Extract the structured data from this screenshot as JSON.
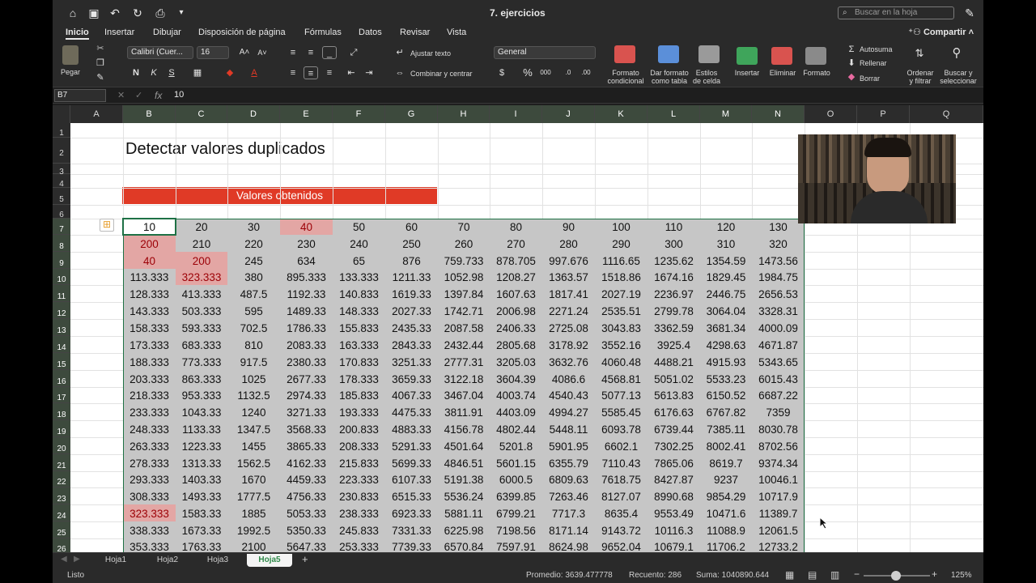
{
  "titlebar": {
    "title": "7. ejercicios",
    "search_placeholder": "Buscar en la hoja"
  },
  "tabs": {
    "items": [
      "Inicio",
      "Insertar",
      "Dibujar",
      "Disposición de página",
      "Fórmulas",
      "Datos",
      "Revisar",
      "Vista"
    ],
    "active": "Inicio",
    "share": "Compartir"
  },
  "ribbon": {
    "paste": "Pegar",
    "font_name": "Calibri (Cuer...",
    "font_size": "16",
    "wrap_text": "Ajustar texto",
    "merge_center": "Combinar y centrar",
    "number_format": "General",
    "cond_format": [
      "Formato",
      "condicional"
    ],
    "format_table": [
      "Dar formato",
      "como tabla"
    ],
    "cell_styles": [
      "Estilos",
      "de celda"
    ],
    "insert": "Insertar",
    "delete": "Eliminar",
    "format": "Formato",
    "autosum": "Autosuma",
    "fill": "Rellenar",
    "clear": "Borrar",
    "sort_filter": [
      "Ordenar",
      "y filtrar"
    ],
    "find_select": [
      "Buscar y",
      "seleccionar"
    ]
  },
  "formula_bar": {
    "name_box": "B7",
    "fx": "fx",
    "value": "10"
  },
  "columns": [
    "A",
    "B",
    "C",
    "D",
    "E",
    "F",
    "G",
    "H",
    "I",
    "J",
    "K",
    "L",
    "M",
    "N",
    "O",
    "P",
    "Q"
  ],
  "rows": [
    "1",
    "2",
    "3",
    "4",
    "5",
    "6",
    "7",
    "8",
    "9",
    "10",
    "11",
    "12",
    "13",
    "14",
    "15",
    "16",
    "17",
    "18",
    "19",
    "20",
    "21",
    "22",
    "23",
    "24",
    "25",
    "26"
  ],
  "sheet": {
    "title": "Detectar valores duplicados",
    "banner": "Valores obtenidos",
    "data_rows": [
      [
        "10",
        "20",
        "30",
        "40",
        "50",
        "60",
        "70",
        "80",
        "90",
        "100",
        "110",
        "120",
        "130"
      ],
      [
        "200",
        "210",
        "220",
        "230",
        "240",
        "250",
        "260",
        "270",
        "280",
        "290",
        "300",
        "310",
        "320"
      ],
      [
        "40",
        "200",
        "245",
        "634",
        "65",
        "876",
        "759.733",
        "878.705",
        "997.676",
        "1116.65",
        "1235.62",
        "1354.59",
        "1473.56"
      ],
      [
        "113.333",
        "323.333",
        "380",
        "895.333",
        "133.333",
        "1211.33",
        "1052.98",
        "1208.27",
        "1363.57",
        "1518.86",
        "1674.16",
        "1829.45",
        "1984.75"
      ],
      [
        "128.333",
        "413.333",
        "487.5",
        "1192.33",
        "140.833",
        "1619.33",
        "1397.84",
        "1607.63",
        "1817.41",
        "2027.19",
        "2236.97",
        "2446.75",
        "2656.53"
      ],
      [
        "143.333",
        "503.333",
        "595",
        "1489.33",
        "148.333",
        "2027.33",
        "1742.71",
        "2006.98",
        "2271.24",
        "2535.51",
        "2799.78",
        "3064.04",
        "3328.31"
      ],
      [
        "158.333",
        "593.333",
        "702.5",
        "1786.33",
        "155.833",
        "2435.33",
        "2087.58",
        "2406.33",
        "2725.08",
        "3043.83",
        "3362.59",
        "3681.34",
        "4000.09"
      ],
      [
        "173.333",
        "683.333",
        "810",
        "2083.33",
        "163.333",
        "2843.33",
        "2432.44",
        "2805.68",
        "3178.92",
        "3552.16",
        "3925.4",
        "4298.63",
        "4671.87"
      ],
      [
        "188.333",
        "773.333",
        "917.5",
        "2380.33",
        "170.833",
        "3251.33",
        "2777.31",
        "3205.03",
        "3632.76",
        "4060.48",
        "4488.21",
        "4915.93",
        "5343.65"
      ],
      [
        "203.333",
        "863.333",
        "1025",
        "2677.33",
        "178.333",
        "3659.33",
        "3122.18",
        "3604.39",
        "4086.6",
        "4568.81",
        "5051.02",
        "5533.23",
        "6015.43"
      ],
      [
        "218.333",
        "953.333",
        "1132.5",
        "2974.33",
        "185.833",
        "4067.33",
        "3467.04",
        "4003.74",
        "4540.43",
        "5077.13",
        "5613.83",
        "6150.52",
        "6687.22"
      ],
      [
        "233.333",
        "1043.33",
        "1240",
        "3271.33",
        "193.333",
        "4475.33",
        "3811.91",
        "4403.09",
        "4994.27",
        "5585.45",
        "6176.63",
        "6767.82",
        "7359"
      ],
      [
        "248.333",
        "1133.33",
        "1347.5",
        "3568.33",
        "200.833",
        "4883.33",
        "4156.78",
        "4802.44",
        "5448.11",
        "6093.78",
        "6739.44",
        "7385.11",
        "8030.78"
      ],
      [
        "263.333",
        "1223.33",
        "1455",
        "3865.33",
        "208.333",
        "5291.33",
        "4501.64",
        "5201.8",
        "5901.95",
        "6602.1",
        "7302.25",
        "8002.41",
        "8702.56"
      ],
      [
        "278.333",
        "1313.33",
        "1562.5",
        "4162.33",
        "215.833",
        "5699.33",
        "4846.51",
        "5601.15",
        "6355.79",
        "7110.43",
        "7865.06",
        "8619.7",
        "9374.34"
      ],
      [
        "293.333",
        "1403.33",
        "1670",
        "4459.33",
        "223.333",
        "6107.33",
        "5191.38",
        "6000.5",
        "6809.63",
        "7618.75",
        "8427.87",
        "9237",
        "10046.1"
      ],
      [
        "308.333",
        "1493.33",
        "1777.5",
        "4756.33",
        "230.833",
        "6515.33",
        "5536.24",
        "6399.85",
        "7263.46",
        "8127.07",
        "8990.68",
        "9854.29",
        "10717.9"
      ],
      [
        "323.333",
        "1583.33",
        "1885",
        "5053.33",
        "238.333",
        "6923.33",
        "5881.11",
        "6799.21",
        "7717.3",
        "8635.4",
        "9553.49",
        "10471.6",
        "11389.7"
      ],
      [
        "338.333",
        "1673.33",
        "1992.5",
        "5350.33",
        "245.833",
        "7331.33",
        "6225.98",
        "7198.56",
        "8171.14",
        "9143.72",
        "10116.3",
        "11088.9",
        "12061.5"
      ],
      [
        "353.333",
        "1763.33",
        "2100",
        "5647.33",
        "253.333",
        "7739.33",
        "6570.84",
        "7597.91",
        "8624.98",
        "9652.04",
        "10679.1",
        "11706.2",
        "12733.2"
      ]
    ],
    "duplicate_color": "#e3a6a4",
    "selection_color": "#c6c6c6",
    "duplicate_cells": [
      "E7",
      "B8",
      "B9",
      "C9",
      "C10",
      "B24"
    ]
  },
  "sheet_tabs": {
    "items": [
      "Hoja1",
      "Hoja2",
      "Hoja3",
      "Hoja5"
    ],
    "active": "Hoja5",
    "add": "+"
  },
  "status": {
    "mode": "Listo",
    "average": "Promedio: 3639.477778",
    "count": "Recuento: 286",
    "sum": "Suma: 1040890.644",
    "zoom": "125%"
  },
  "colors": {
    "banner": "#e03a26",
    "ribbon_bg": "#2a2a2a",
    "sheet_tab_active": "#2f8a4a"
  },
  "icons": [
    "home-icon",
    "save-icon",
    "undo-icon",
    "redo-icon",
    "print-icon",
    "search-icon",
    "share-icon",
    "paste-icon",
    "cut-icon",
    "copy-icon",
    "format-painter-icon",
    "bold-icon",
    "italic-icon",
    "underline-icon",
    "fill-color-icon",
    "font-color-icon",
    "align-left-icon",
    "align-center-icon",
    "align-right-icon",
    "wrap-text-icon",
    "merge-icon",
    "currency-icon",
    "percent-icon",
    "comma-icon",
    "cond-format-icon",
    "table-icon",
    "cell-styles-icon",
    "insert-icon",
    "delete-icon",
    "format-icon",
    "autosum-icon",
    "fill-icon",
    "clear-icon",
    "sort-filter-icon",
    "find-icon",
    "paste-options-icon"
  ]
}
